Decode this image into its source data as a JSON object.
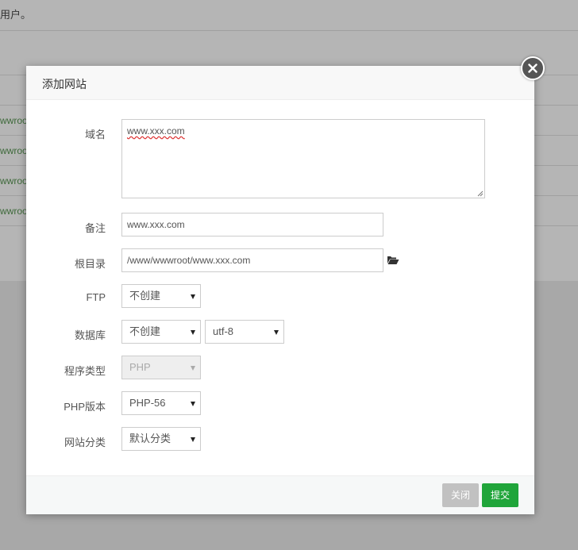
{
  "background": {
    "top_text": "用户。",
    "rows": [
      "wwroo",
      "wwroo",
      "wwroo",
      "wwroo"
    ]
  },
  "modal": {
    "title": "添加网站",
    "close_icon": "close-icon",
    "fields": {
      "domain_label": "域名",
      "domain_value": "www.xxx.com",
      "remark_label": "备注",
      "remark_value": "www.xxx.com",
      "root_label": "根目录",
      "root_value": "/www/wwwroot/www.xxx.com",
      "ftp_label": "FTP",
      "ftp_value": "不创建",
      "db_label": "数据库",
      "db_value": "不创建",
      "db_charset": "utf-8",
      "program_label": "程序类型",
      "program_value": "PHP",
      "php_label": "PHP版本",
      "php_value": "PHP-56",
      "category_label": "网站分类",
      "category_value": "默认分类"
    },
    "footer": {
      "close_label": "关闭",
      "submit_label": "提交"
    }
  },
  "colors": {
    "submit": "#20a53a",
    "close": "#c1c1c1",
    "overlay": "#a9a9a9"
  }
}
